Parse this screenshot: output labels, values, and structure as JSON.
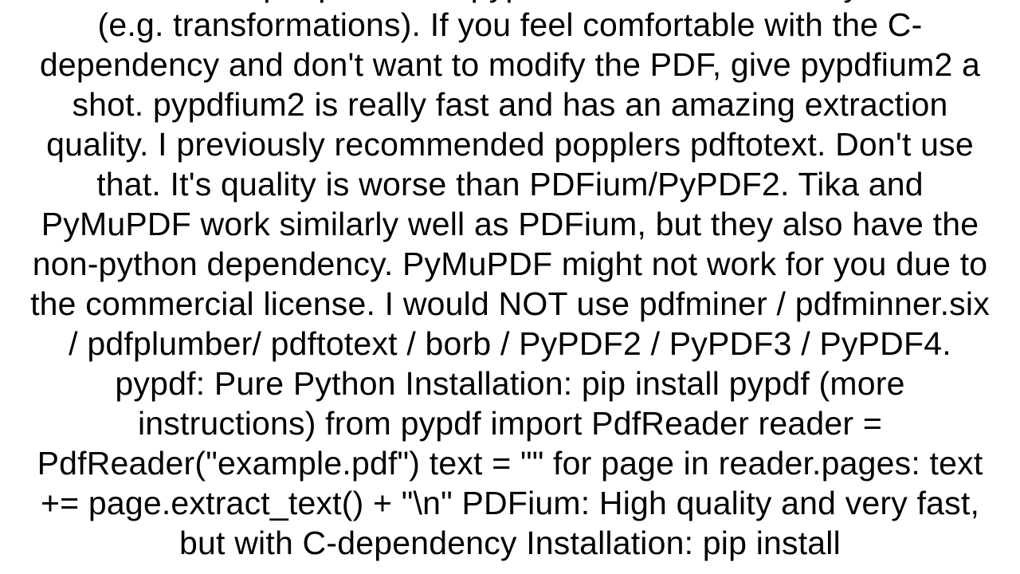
{
  "document": {
    "body": "I'd recommend people to use pypdf as it can also modify the files (e.g. transformations). If you feel comfortable with the C-dependency and don't want to modify the PDF, give pypdfium2 a shot. pypdfium2 is really fast and has an amazing extraction quality. I previously recommended popplers pdftotext. Don't use that. It's quality is worse than PDFium/PyPDF2. Tika and PyMuPDF work similarly well as PDFium, but they also have the non-python dependency. PyMuPDF might not work for you due to the commercial license. I would NOT use pdfminer / pdfminner.six / pdfplumber/ pdftotext / borb / PyPDF2 / PyPDF3 / PyPDF4. pypdf: Pure Python Installation: pip install pypdf (more instructions) from pypdf import PdfReader  reader = PdfReader(\"example.pdf\") text = \"\" for page in reader.pages:     text += page.extract_text() + \"\\n\"  PDFium: High quality and very fast, but with C-dependency Installation: pip install"
  }
}
